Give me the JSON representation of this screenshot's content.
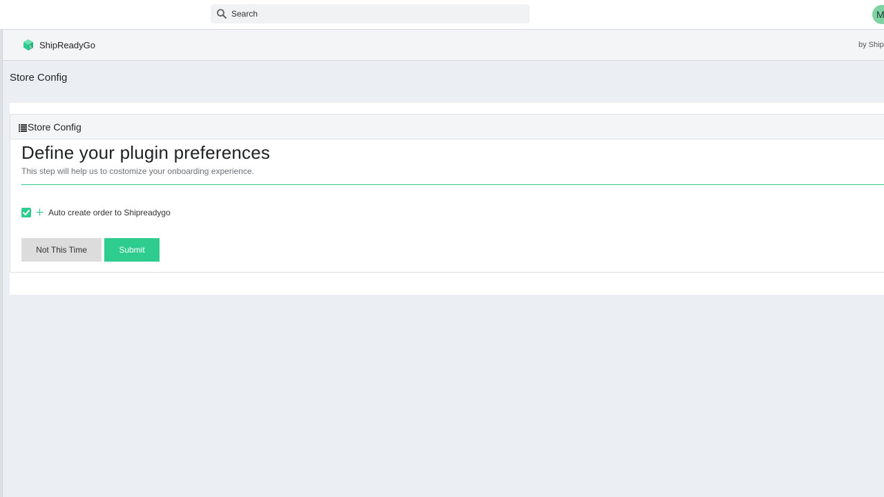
{
  "topbar": {
    "search_placeholder": "Search",
    "avatar_initial": "M"
  },
  "app": {
    "name": "ShipReadyGo",
    "by_text": "by Ship",
    "brand_color": "#2ecc8f"
  },
  "page": {
    "title": "Store Config"
  },
  "card": {
    "header_title": "Store Config",
    "heading": "Define your plugin preferences",
    "subtext": "This step will help us to costomize your onboarding experience.",
    "option": {
      "label": "Auto create order to Shipreadygo",
      "checked": true
    },
    "buttons": {
      "secondary_label": "Not This Time",
      "primary_label": "Submit"
    }
  },
  "icons": [
    "search-icon",
    "logo-icon",
    "list-icon",
    "check-icon",
    "plus-icon"
  ]
}
